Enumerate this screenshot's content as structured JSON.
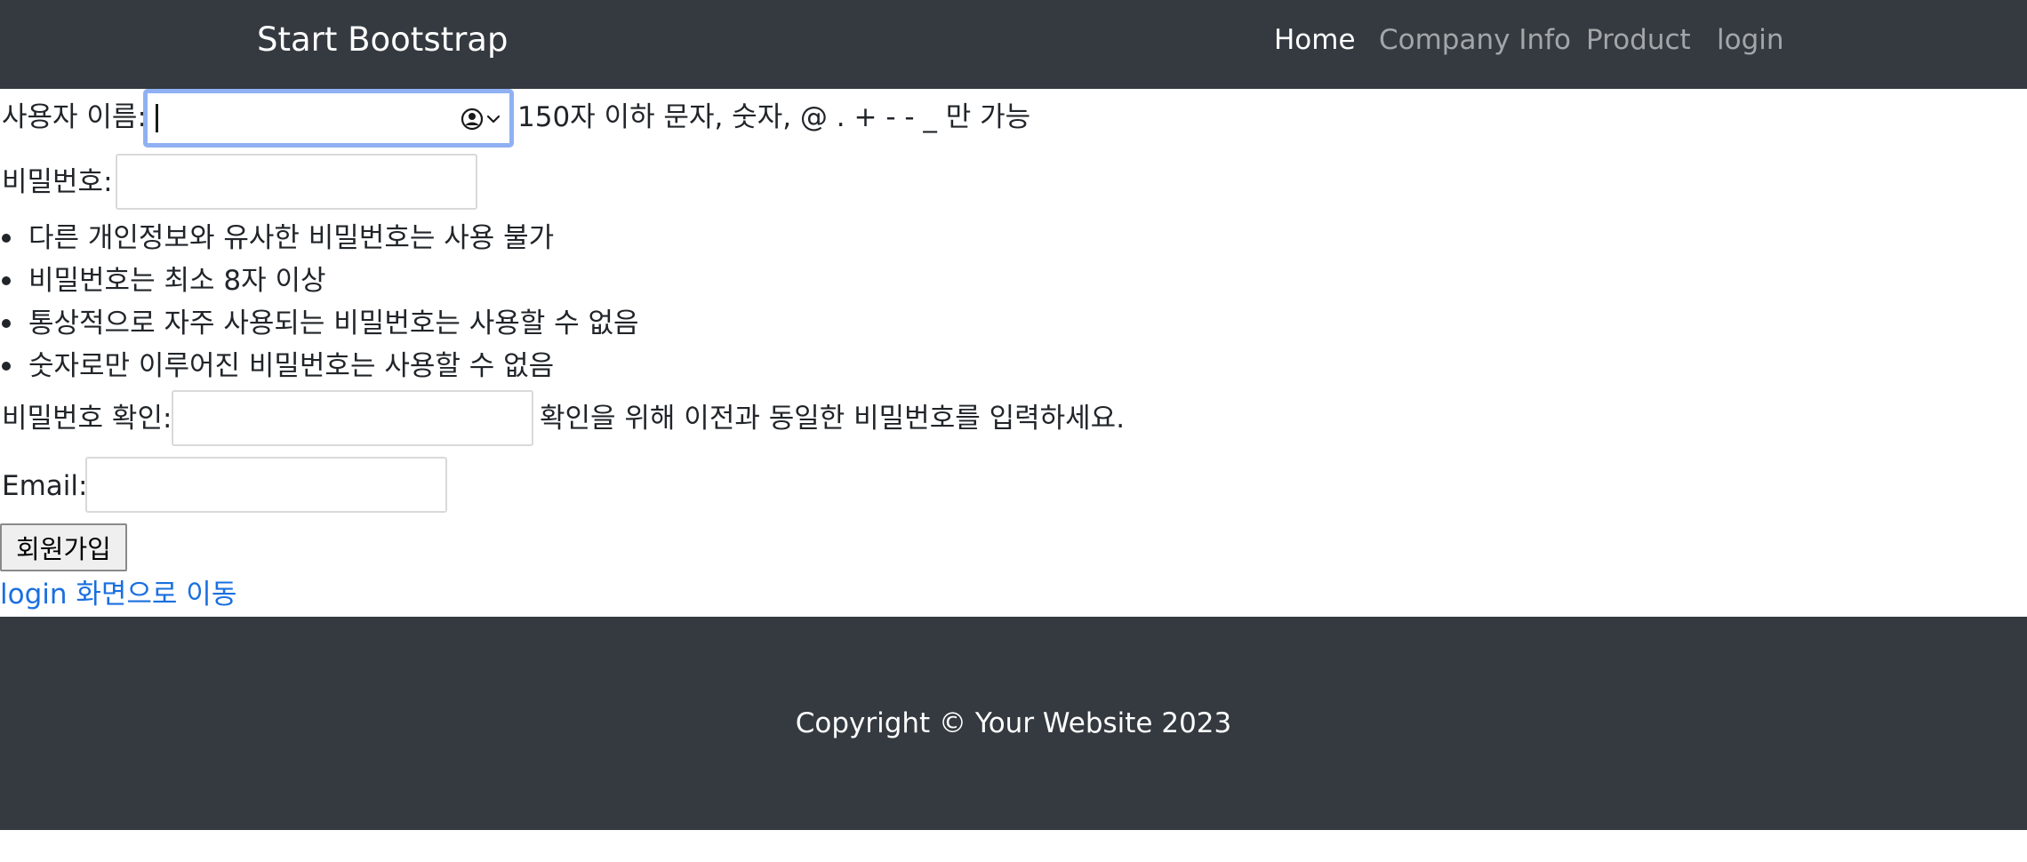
{
  "navbar": {
    "brand": "Start Bootstrap",
    "links": [
      {
        "label": "Home",
        "active": true
      },
      {
        "label": "Company Info",
        "active": false
      },
      {
        "label": "Product",
        "active": false
      },
      {
        "label": "login",
        "active": false
      }
    ]
  },
  "form": {
    "username": {
      "label": "사용자 이름:",
      "value": "",
      "help": "150자 이하 문자, 숫자, @ . + - - _ 만 가능",
      "autofill_icon": "person-circle-icon"
    },
    "password": {
      "label": "비밀번호:",
      "value": "",
      "rules": [
        "다른 개인정보와 유사한 비밀번호는 사용 불가",
        "비밀번호는 최소 8자 이상",
        "통상적으로 자주 사용되는 비밀번호는 사용할 수 없음",
        "숫자로만 이루어진 비밀번호는 사용할 수 없음"
      ]
    },
    "password_confirm": {
      "label": "비밀번호 확인:",
      "value": "",
      "help": "확인을 위해 이전과 동일한 비밀번호를 입력하세요."
    },
    "email": {
      "label": "Email:",
      "value": ""
    },
    "submit_label": "회원가입",
    "login_link": "login 화면으로 이동"
  },
  "footer": {
    "copyright": "Copyright © Your Website 2023"
  },
  "colors": {
    "navbar_bg": "#343a40",
    "link_blue": "#1a6fe0",
    "focus_ring": "#8fb1f3"
  }
}
